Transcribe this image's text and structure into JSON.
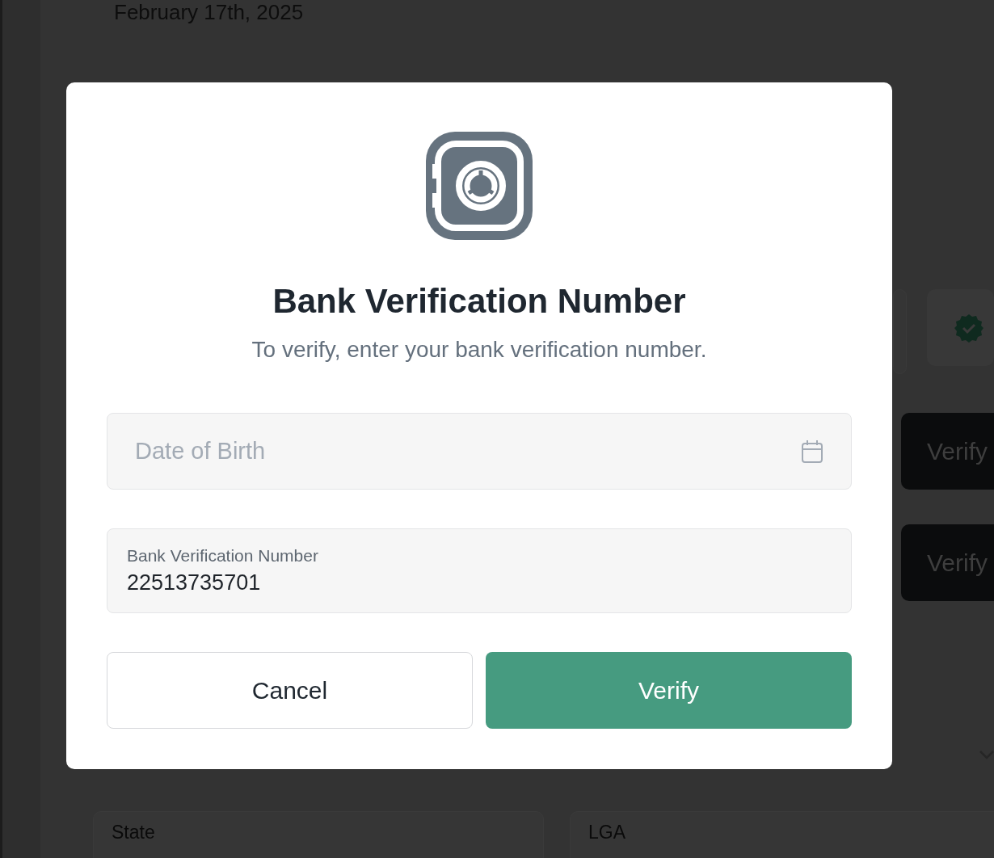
{
  "background": {
    "date": "February 17th, 2025",
    "verify_buttons": [
      "Verify",
      "Verify"
    ],
    "fields": [
      {
        "label": "State"
      },
      {
        "label": "LGA"
      }
    ]
  },
  "dialog": {
    "title": "Bank Verification Number",
    "subtitle": "To verify, enter your bank verification number.",
    "fields": [
      {
        "kind": "date",
        "placeholder": "Date of Birth"
      },
      {
        "kind": "text",
        "label": "Bank Verification Number",
        "value": "22513735701"
      }
    ],
    "buttons": [
      {
        "kind": "secondary",
        "label": "Cancel"
      },
      {
        "kind": "primary",
        "label": "Verify"
      }
    ]
  }
}
